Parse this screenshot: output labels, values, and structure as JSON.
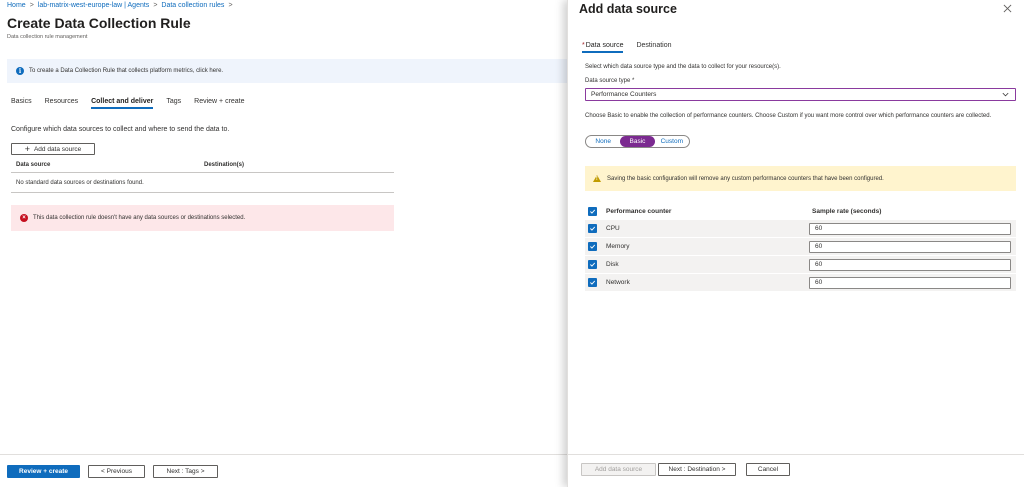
{
  "breadcrumb": {
    "items": [
      "Home",
      "lab-matrix-west-europe-law | Agents",
      "Data collection rules"
    ],
    "separator": ">"
  },
  "page": {
    "title": "Create Data Collection Rule",
    "more": "...",
    "subtitle": "Data collection rule management",
    "info_banner": "To create a Data Collection Rule that collects platform metrics, click here.",
    "tabs": [
      "Basics",
      "Resources",
      "Collect and deliver",
      "Tags",
      "Review + create"
    ],
    "active_tab": "Collect and deliver",
    "configure_text": "Configure which data sources to collect and where to send the data to.",
    "add_button": "Add data source",
    "table": {
      "columns": [
        "Data source",
        "Destination(s)"
      ],
      "empty_text": "No standard data sources or destinations found."
    },
    "error_banner": "This data collection rule doesn't have any data sources or destinations selected.",
    "footer": {
      "review_create": "Review + create",
      "previous": "< Previous",
      "next": "Next : Tags >"
    }
  },
  "panel": {
    "title": "Add data source",
    "tabs": [
      "Data source",
      "Destination"
    ],
    "required_marker": "*",
    "description": "Select which data source type and the data to collect for your resource(s).",
    "type_label": "Data source type *",
    "type_value": "Performance Counters",
    "basic_description": "Choose Basic to enable the collection of performance counters. Choose Custom if you want more control over which performance counters are collected.",
    "segments": [
      "None",
      "Basic",
      "Custom"
    ],
    "active_segment": "Basic",
    "warning": "Saving the basic configuration will remove any custom performance counters that have been configured.",
    "counters_table": {
      "columns": [
        "Performance counter",
        "Sample rate (seconds)"
      ],
      "rows": [
        {
          "name": "CPU",
          "rate": "60",
          "checked": true
        },
        {
          "name": "Memory",
          "rate": "60",
          "checked": true
        },
        {
          "name": "Disk",
          "rate": "60",
          "checked": true
        },
        {
          "name": "Network",
          "rate": "60",
          "checked": true
        }
      ]
    },
    "footer": {
      "add": "Add data source",
      "next": "Next : Destination >",
      "cancel": "Cancel"
    }
  },
  "colors": {
    "accent": "#0f6cbd",
    "segment_active": "#7b2a90",
    "error_bg": "#fde7e9",
    "warning_bg": "#fff4ce",
    "info_bg": "#eff4fc"
  },
  "icons": [
    "info-icon",
    "error-icon",
    "warning-icon",
    "close-icon",
    "chevron-down-icon",
    "plus-icon",
    "checkbox-checked-icon"
  ]
}
